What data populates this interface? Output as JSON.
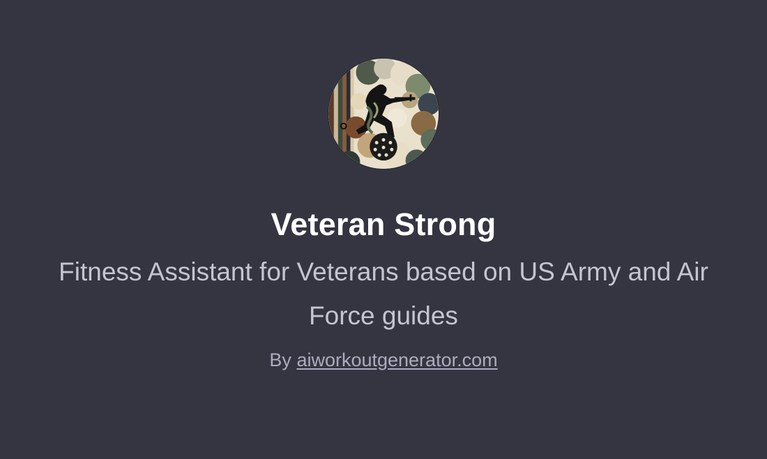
{
  "gpt": {
    "avatar_icon": "soldier-camouflage-avatar-icon",
    "name": "Veteran Strong",
    "description": "Fitness Assistant for Veterans based on US Army and Air Force guides",
    "byline_prefix": "By",
    "author_link": "aiworkoutgenerator.com"
  },
  "colors": {
    "background": "#343541",
    "title": "#ffffff",
    "description": "#c5c5d2",
    "byline": "#acacbe"
  }
}
